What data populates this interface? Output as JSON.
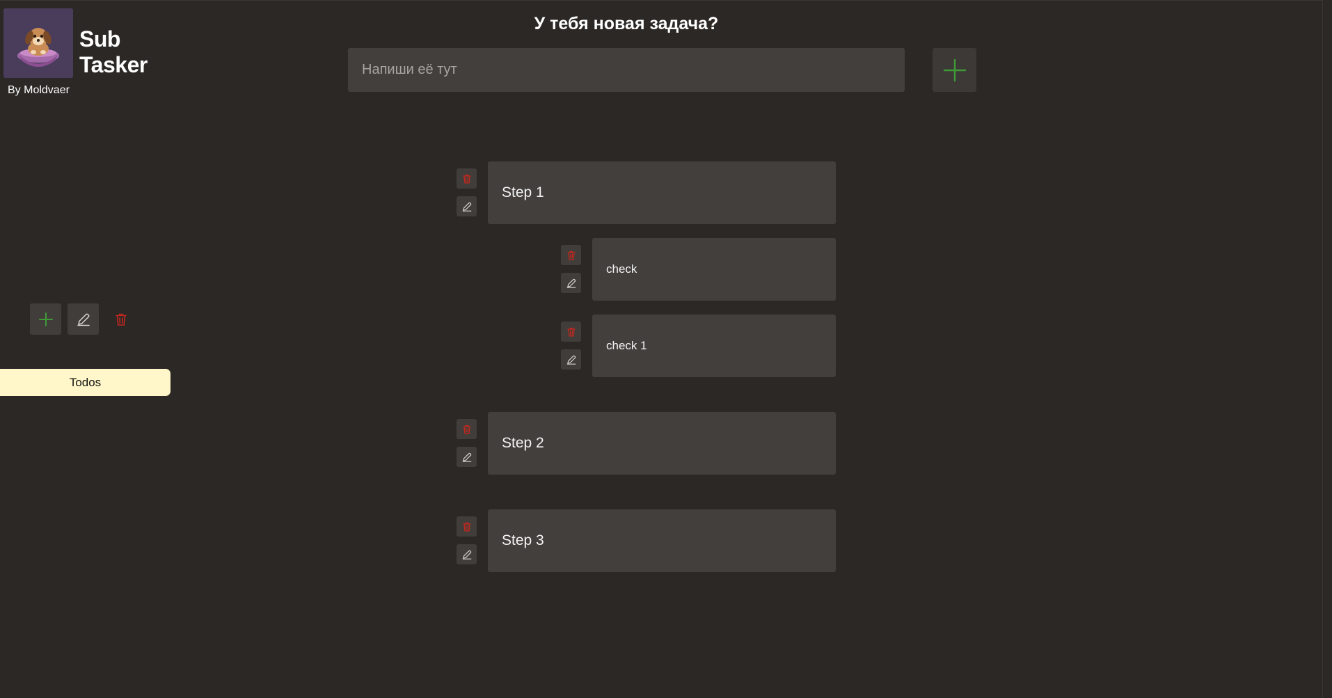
{
  "app": {
    "title_line1": "Sub",
    "title_line2": "Tasker",
    "author": "By Moldvaer"
  },
  "sidebar": {
    "actions": [
      {
        "icon": "plus-icon",
        "color": "#3f9a35"
      },
      {
        "icon": "pencil-icon",
        "color": "#d9d6d3"
      },
      {
        "icon": "trash-icon",
        "color": "#c2281e"
      }
    ],
    "lists": [
      {
        "label": "Todos",
        "active": true
      }
    ]
  },
  "header": {
    "prompt": "У тебя новая задача?",
    "input_placeholder": "Напиши её тут",
    "input_value": "",
    "add_icon": "plus-icon"
  },
  "tasks": [
    {
      "label": "Step 1",
      "subtasks": [
        {
          "label": "check"
        },
        {
          "label": "check 1"
        }
      ]
    },
    {
      "label": "Step 2",
      "subtasks": []
    },
    {
      "label": "Step 3",
      "subtasks": []
    }
  ],
  "colors": {
    "background": "#2b2826",
    "card": "#433f3d",
    "accent_green": "#3f9a35",
    "delete_red": "#c2281e",
    "active_list": "#fff7c9"
  }
}
